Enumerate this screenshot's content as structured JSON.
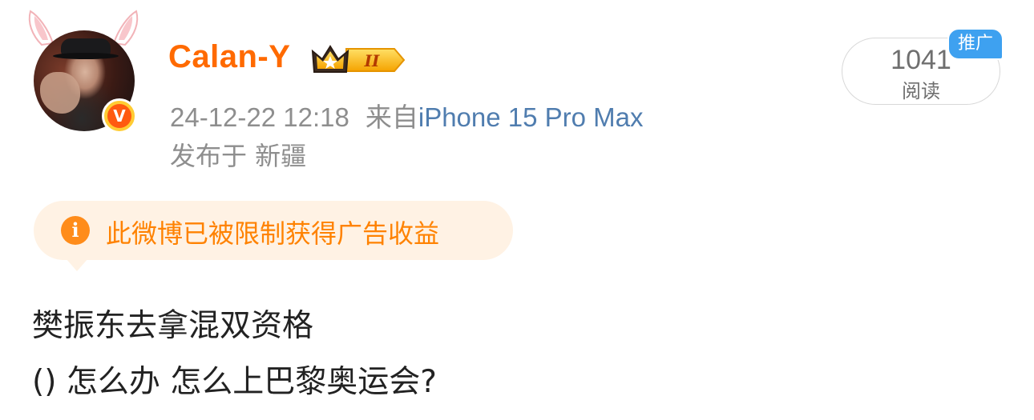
{
  "user": {
    "name": "Calan-Y",
    "verified_badge": "V",
    "rank_icon": "crown-rank-badge",
    "rank_label": "II"
  },
  "meta": {
    "timestamp": "24-12-22 12:18",
    "source_prefix": "来自",
    "device": "iPhone 15 Pro Max",
    "location": "发布于 新疆"
  },
  "reads": {
    "count": "1041",
    "label": "阅读",
    "promo_label": "推广"
  },
  "notice": {
    "icon": "info-icon",
    "icon_glyph": "i",
    "text": "此微博已被限制获得广告收益"
  },
  "post": {
    "line1": "樊振东去拿混双资格",
    "line2": "() 怎么办 怎么上巴黎奥运会?"
  },
  "colors": {
    "username": "#ff6a00",
    "device_link": "#507daf",
    "notice_bg": "#fff2e4",
    "notice_text": "#ff8200",
    "promo_bg": "#3ea1f0"
  }
}
